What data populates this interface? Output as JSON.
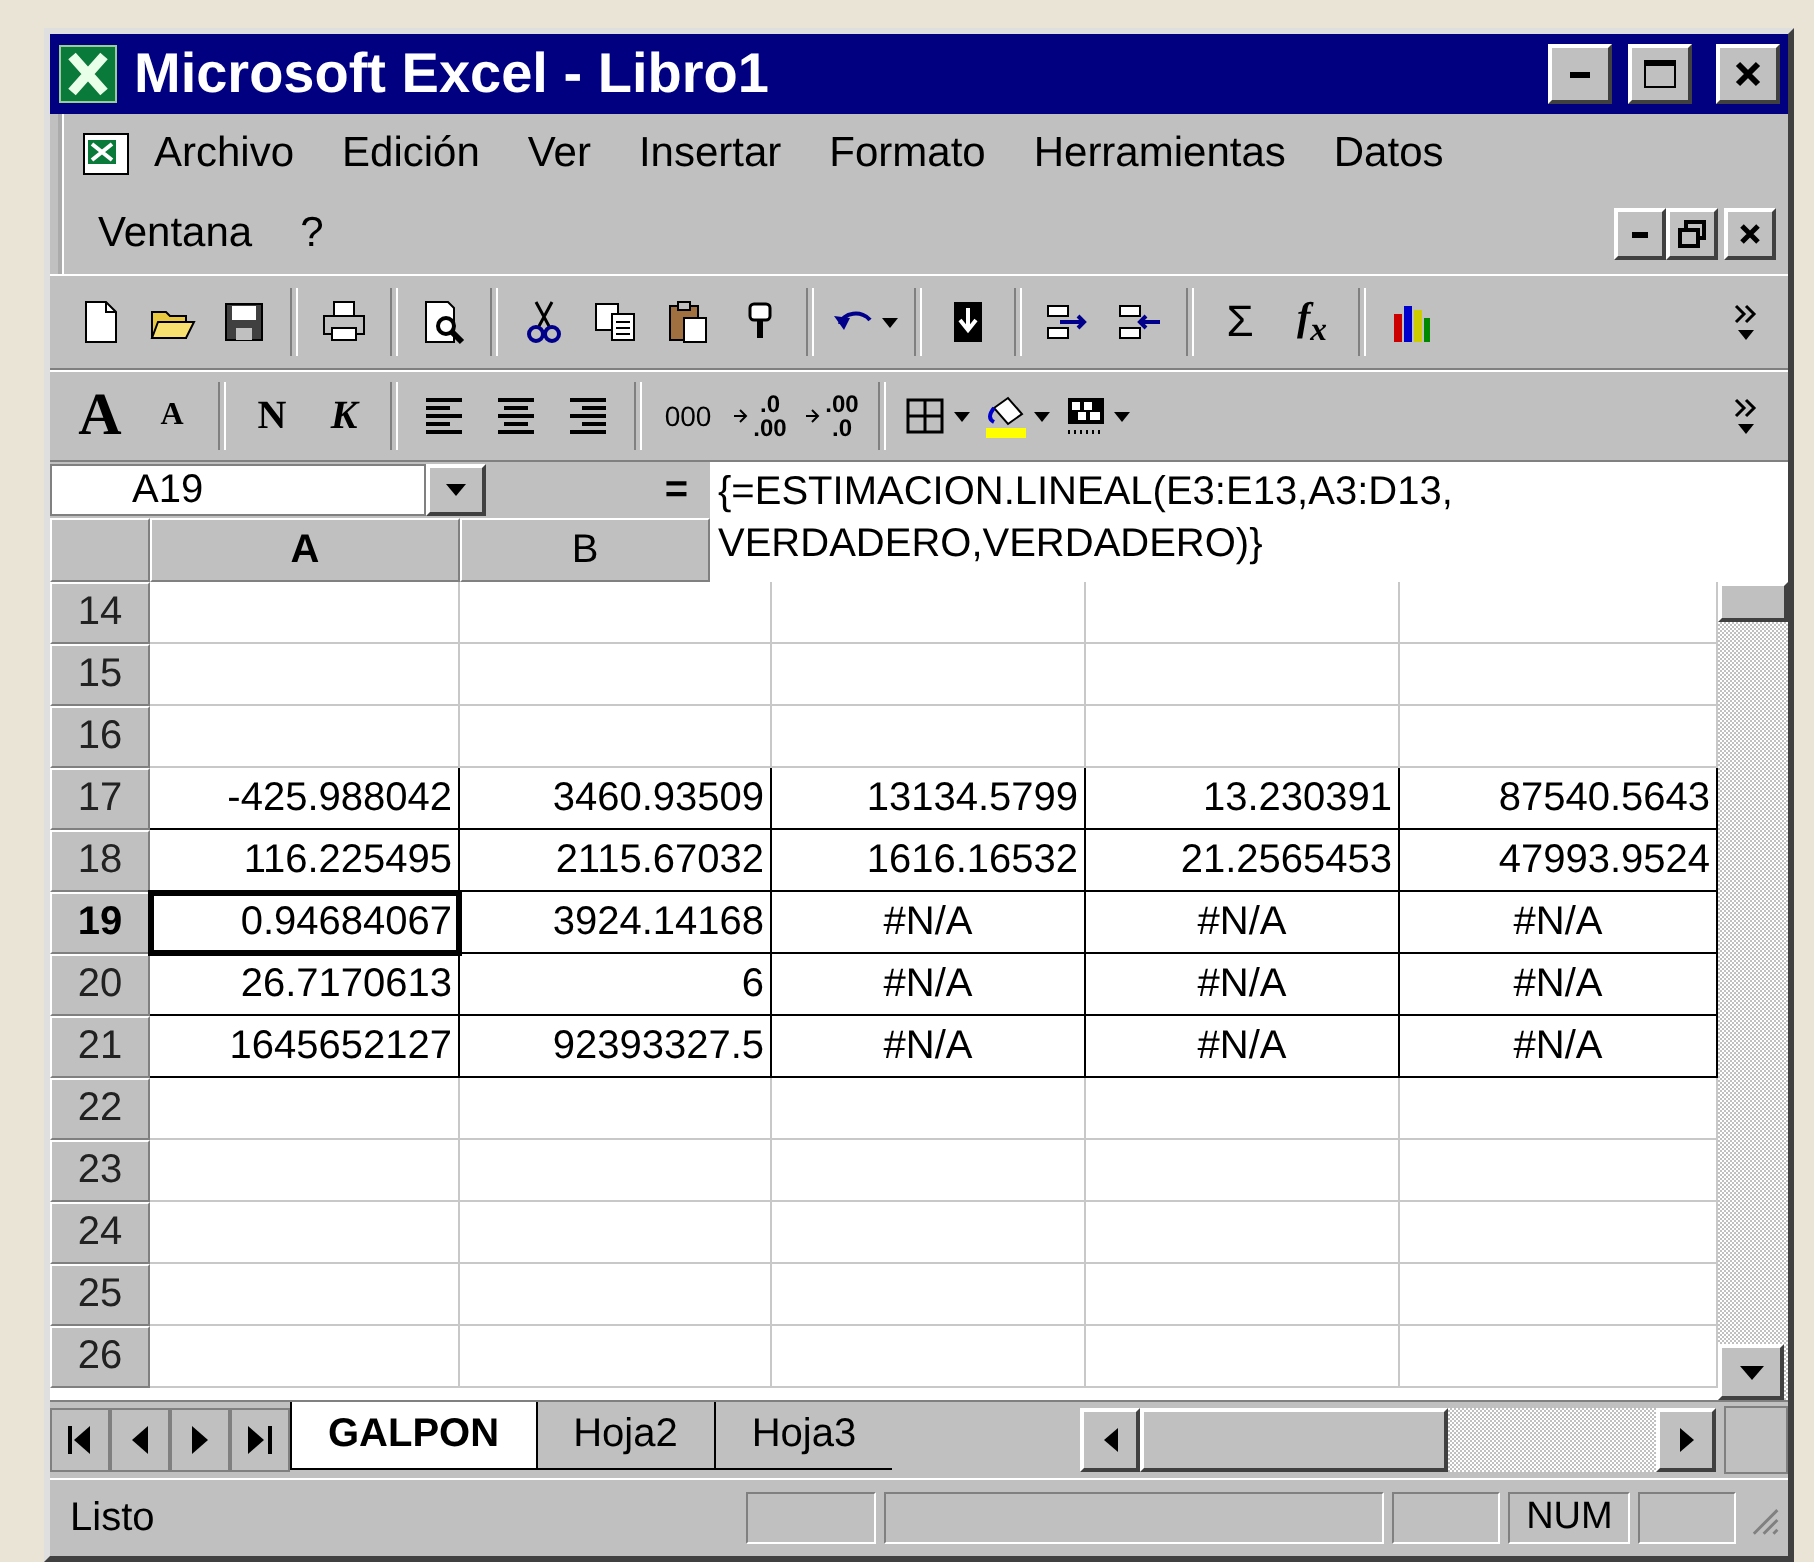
{
  "window": {
    "title": "Microsoft Excel - Libro1"
  },
  "menu": [
    "Archivo",
    "Edición",
    "Ver",
    "Insertar",
    "Formato",
    "Herramientas",
    "Datos",
    "Ventana",
    "?"
  ],
  "toolbar_1": {
    "sum": "Σ",
    "function": "f$_{x}$"
  },
  "toolbar_2": {
    "grow_font": "A",
    "shrink_font": "A",
    "bold": "N",
    "italic": "K",
    "thousands": "000",
    "add_decimal_top": ".0",
    "add_decimal_bottom": ".00",
    "remove_decimal_top": ".00",
    "remove_decimal_bottom": ".0"
  },
  "formula_bar": {
    "name_box": "A19",
    "equals": "=",
    "formula": [
      "{=ESTIMACION.LINEAL(E3:E13,A3:D13,",
      "VERDADERO,VERDADERO)}"
    ]
  },
  "columns": [
    {
      "label": "A",
      "selected": true
    },
    {
      "label": "B",
      "selected": false
    }
  ],
  "rows": [
    {
      "header": "14",
      "selected": false,
      "bordered": false
    },
    {
      "header": "15",
      "selected": false,
      "bordered": false
    },
    {
      "header": "16",
      "selected": false,
      "bordered": false
    },
    {
      "header": "17",
      "selected": false,
      "bordered": true,
      "cells": [
        {
          "value": "-425.988042",
          "kind": "number",
          "active": false
        },
        {
          "value": "3460.93509",
          "kind": "number",
          "active": false
        },
        {
          "value": "13134.5799",
          "kind": "number",
          "active": false
        },
        {
          "value": "13.230391",
          "kind": "number",
          "active": false
        },
        {
          "value": "87540.5643",
          "kind": "number",
          "active": false
        }
      ]
    },
    {
      "header": "18",
      "selected": false,
      "bordered": true,
      "cells": [
        {
          "value": "116.225495",
          "kind": "number",
          "active": false
        },
        {
          "value": "2115.67032",
          "kind": "number",
          "active": false
        },
        {
          "value": "1616.16532",
          "kind": "number",
          "active": false
        },
        {
          "value": "21.2565453",
          "kind": "number",
          "active": false
        },
        {
          "value": "47993.9524",
          "kind": "number",
          "active": false
        }
      ]
    },
    {
      "header": "19",
      "selected": true,
      "bordered": true,
      "cells": [
        {
          "value": "0.94684067",
          "kind": "number",
          "active": true
        },
        {
          "value": "3924.14168",
          "kind": "number",
          "active": false
        },
        {
          "value": "#N/A",
          "kind": "error",
          "active": false
        },
        {
          "value": "#N/A",
          "kind": "error",
          "active": false
        },
        {
          "value": "#N/A",
          "kind": "error",
          "active": false
        }
      ]
    },
    {
      "header": "20",
      "selected": false,
      "bordered": true,
      "cells": [
        {
          "value": "26.7170613",
          "kind": "number",
          "active": false
        },
        {
          "value": "6",
          "kind": "number",
          "active": false
        },
        {
          "value": "#N/A",
          "kind": "error",
          "active": false
        },
        {
          "value": "#N/A",
          "kind": "error",
          "active": false
        },
        {
          "value": "#N/A",
          "kind": "error",
          "active": false
        }
      ]
    },
    {
      "header": "21",
      "selected": false,
      "bordered": true,
      "cells": [
        {
          "value": "1645652127",
          "kind": "number",
          "active": false
        },
        {
          "value": "92393327.5",
          "kind": "number",
          "active": false
        },
        {
          "value": "#N/A",
          "kind": "error",
          "active": false
        },
        {
          "value": "#N/A",
          "kind": "error",
          "active": false
        },
        {
          "value": "#N/A",
          "kind": "error",
          "active": false
        }
      ]
    },
    {
      "header": "22",
      "selected": false,
      "bordered": false
    },
    {
      "header": "23",
      "selected": false,
      "bordered": false
    },
    {
      "header": "24",
      "selected": false,
      "bordered": false
    },
    {
      "header": "25",
      "selected": false,
      "bordered": false
    },
    {
      "header": "26",
      "selected": false,
      "bordered": false
    }
  ],
  "sheet_tabs": [
    {
      "label": "GALPON",
      "selected": true
    },
    {
      "label": "Hoja2",
      "selected": false
    },
    {
      "label": "Hoja3",
      "selected": false
    }
  ],
  "status_bar": {
    "message": "Listo",
    "indicators": [
      "NUM"
    ]
  }
}
